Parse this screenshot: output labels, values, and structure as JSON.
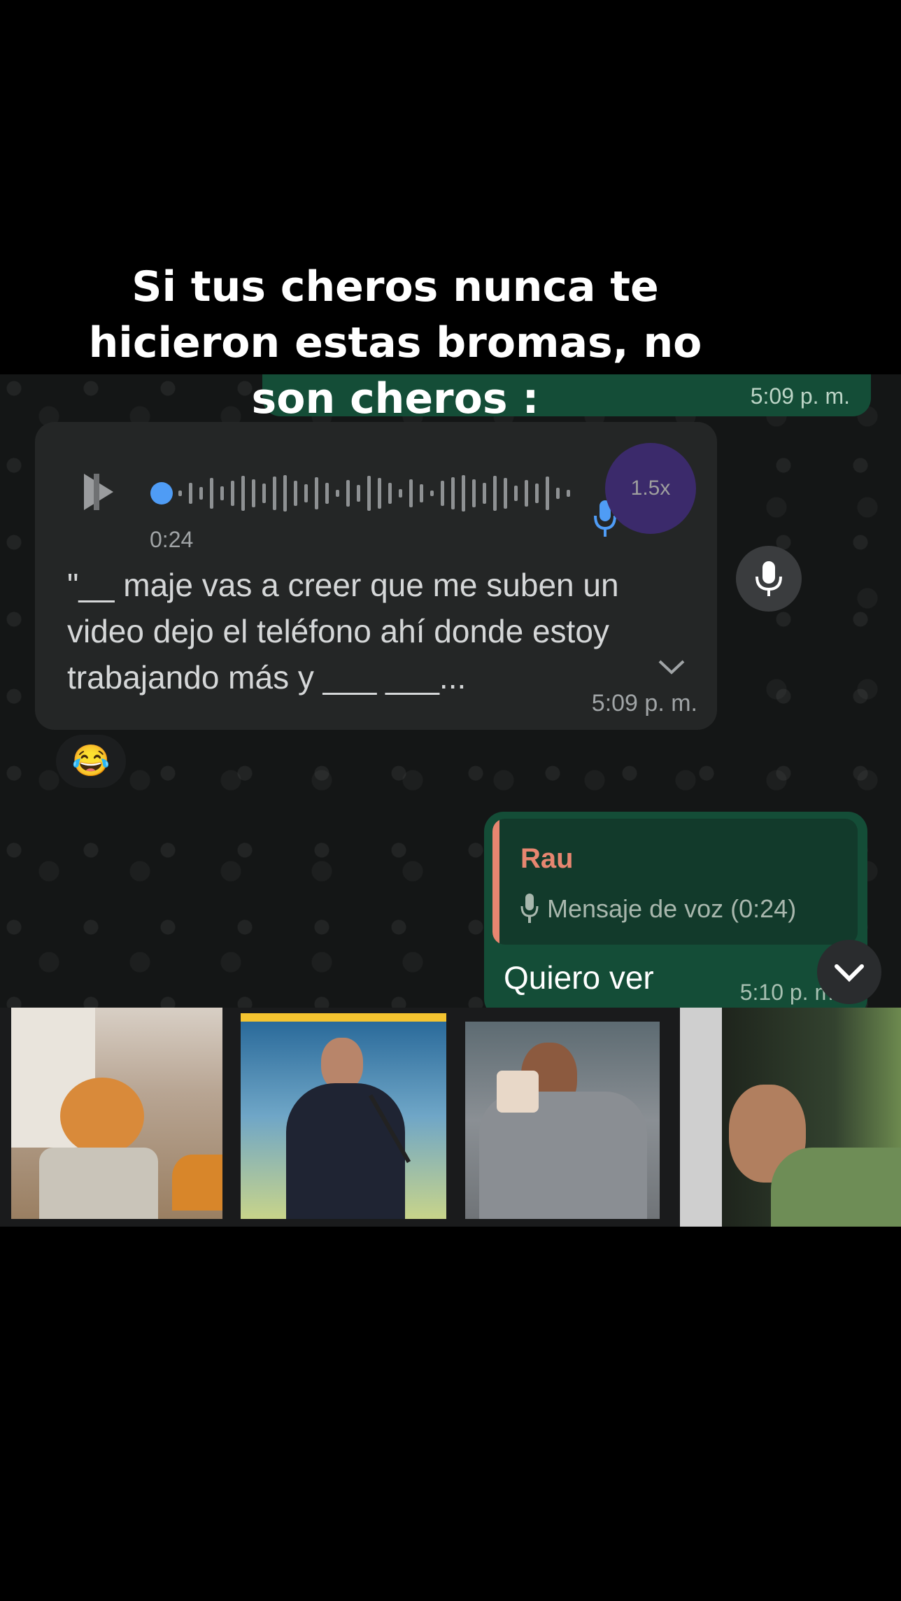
{
  "caption": "Si tus cheros nunca te hicieron estas bromas, no son cheros :",
  "chat": {
    "top_message_time": "5:09 p. m.",
    "voice_message": {
      "speed": "1.5x",
      "duration": "0:24",
      "transcript": "\"__ maje vas a creer que me suben un video dejo el teléfono ahí donde estoy trabajando más y ___ ___...",
      "time": "5:09 p. m.",
      "reaction": "😂"
    },
    "reply_message": {
      "quoted_name": "Rau",
      "quoted_label": "Mensaje de voz (0:24)",
      "text": "Quiero ver",
      "time": "5:10 p. m."
    }
  },
  "icons": [
    "play-icon",
    "waveform",
    "speed-toggle",
    "mic-icon",
    "chevron-down-icon",
    "scroll-down-icon"
  ],
  "colors": {
    "background": "#000000",
    "chat_bg": "#141616",
    "incoming_bubble": "#242626",
    "outgoing_bubble": "#144d37",
    "quote_accent": "#e78670",
    "waveform_dot": "#4f9cf5",
    "speed_btn": "#3b2a6b"
  }
}
